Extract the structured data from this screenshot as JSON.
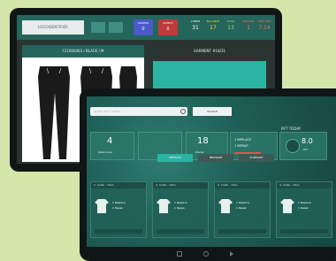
{
  "back_tablet": {
    "logo": "LOGOIDENTIFIER",
    "chips": [
      {
        "label": "ORDERS",
        "value": "0",
        "color": "#4a58c8"
      },
      {
        "label": "ALERTS",
        "value": "0",
        "color": "#c0393b"
      }
    ],
    "stats": [
      {
        "label": "LABOR",
        "value": "31",
        "color": "#ffffff"
      },
      {
        "label": "BALANCE",
        "value": "17",
        "color": "#ffd12a"
      },
      {
        "label": "TOTAL",
        "value": "13",
        "color": "#9be564"
      },
      {
        "label": "REWORK",
        "value": "1",
        "color": "#ff6b5a"
      },
      {
        "label": "REJECTED",
        "value": "7.14",
        "color": "#ff6b5a"
      }
    ],
    "left_panel_title": "F21000403 / BLACK / M",
    "right_panel_title": "GARMENT #18/31"
  },
  "front_tablet": {
    "search_placeholder": "Search item / batch",
    "search_button": "SEARCH",
    "section_label": "RFT TODAY",
    "stat_cards": [
      {
        "value": "4",
        "label": "Defectives"
      },
      {
        "value": "18",
        "label": "Pieces"
      }
    ],
    "replace_label": "1  REPLACE",
    "repair_label": "1  REPAIR",
    "rft_value": "8.0",
    "rft_label": "RFT",
    "tabs": [
      "DEFECTS",
      "MEASURE",
      "SUMMARY"
    ],
    "items": [
      {
        "title": "1. Collar - Hem",
        "lines": [
          "1  Replace",
          "1  Repair"
        ]
      },
      {
        "title": "2. Collar - Hem",
        "lines": [
          "1  Replace",
          "1  Repair"
        ]
      },
      {
        "title": "3. Collar - Hem",
        "lines": [
          "1  Replace",
          "1  Repair"
        ]
      },
      {
        "title": "4. Collar - Hem",
        "lines": [
          "1  Replace",
          "1  Repair"
        ]
      }
    ]
  }
}
